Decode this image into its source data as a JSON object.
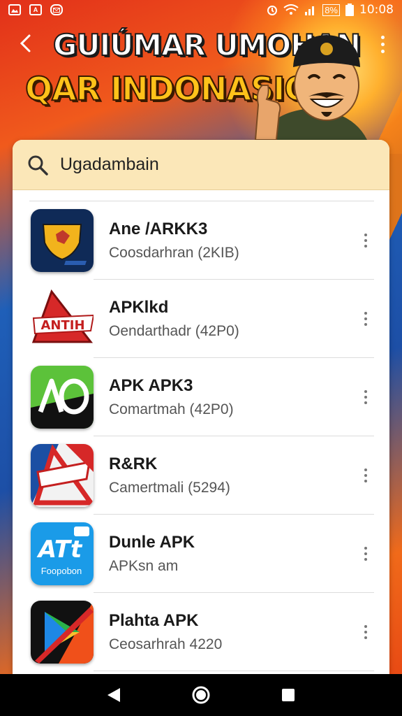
{
  "status_bar": {
    "time": "10:08",
    "battery_label": "8%",
    "left_icons": [
      "image-icon",
      "font-icon",
      "mail-icon"
    ],
    "right_icons": [
      "alarm-icon",
      "wifi-icon",
      "signal-icon",
      "battery-icon"
    ]
  },
  "header": {
    "title_line1": "GUIÚMAR UMOHAN",
    "title_line2": "QAR INDONASIO",
    "back_icon": "back-arrow-icon",
    "more_icon": "more-vertical-icon"
  },
  "search": {
    "value": "Ugadambain",
    "icon": "search-icon"
  },
  "apps": [
    {
      "name": "Ane /ARKK3",
      "subtitle": "Coosdarhran (2KIB)",
      "icon": "shield-app-icon"
    },
    {
      "name": "APKlkd",
      "subtitle": "Oendarthadr (42P0)",
      "icon": "antih-app-icon",
      "icon_text": "ANTIH"
    },
    {
      "name": "APK APK3",
      "subtitle": "Comartmah (42P0)",
      "icon": "ao-app-icon"
    },
    {
      "name": "R&RK",
      "subtitle": "Camertmali (5294)",
      "icon": "triangle-app-icon"
    },
    {
      "name": "Dunle APK",
      "subtitle": "APKsn am",
      "icon": "atl-app-icon",
      "icon_text": "ATt",
      "icon_subtext": "Foopobon"
    },
    {
      "name": "Plahta APK",
      "subtitle": "Ceosarhrah 4220",
      "icon": "play-app-icon"
    }
  ],
  "nav": {
    "back_icon": "nav-back-icon",
    "home_icon": "nav-home-icon",
    "recents_icon": "nav-recents-icon"
  },
  "colors": {
    "search_bg": "#fbe7b8",
    "title_yellow": "#ffc21a",
    "banner_blue": "#1d4fa6",
    "banner_orange": "#f05a1c"
  }
}
